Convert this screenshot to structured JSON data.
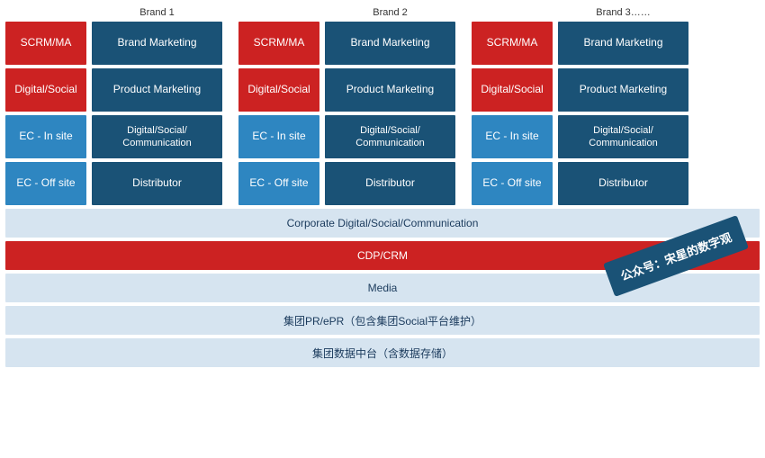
{
  "brands": [
    "Brand 1",
    "Brand 2",
    "Brand 3……"
  ],
  "rows": [
    {
      "cells": [
        {
          "label": "SCRM/MA",
          "type": "red",
          "width": "narrow"
        },
        {
          "label": "Brand Marketing",
          "type": "blue",
          "width": "wide"
        },
        {
          "label": "SCRM/MA",
          "type": "red",
          "width": "narrow"
        },
        {
          "label": "Brand Marketing",
          "type": "blue",
          "width": "wide"
        },
        {
          "label": "SCRM/MA",
          "type": "red",
          "width": "narrow"
        },
        {
          "label": "Brand Marketing",
          "type": "blue",
          "width": "wide"
        }
      ]
    },
    {
      "cells": [
        {
          "label": "Digital/Social",
          "type": "red",
          "width": "narrow"
        },
        {
          "label": "Product Marketing",
          "type": "blue",
          "width": "wide"
        },
        {
          "label": "Digital/Social",
          "type": "red",
          "width": "narrow"
        },
        {
          "label": "Product Marketing",
          "type": "blue",
          "width": "wide"
        },
        {
          "label": "Digital/Social",
          "type": "red",
          "width": "narrow"
        },
        {
          "label": "Product Marketing",
          "type": "blue",
          "width": "wide"
        }
      ]
    },
    {
      "cells": [
        {
          "label": "EC - In site",
          "type": "blue",
          "width": "narrow"
        },
        {
          "label": "Digital/Social/\nCommunication",
          "type": "blue",
          "width": "wide"
        },
        {
          "label": "EC - In site",
          "type": "blue",
          "width": "narrow"
        },
        {
          "label": "Digital/Social/\nCommunication",
          "type": "blue",
          "width": "wide"
        },
        {
          "label": "EC - In site",
          "type": "blue",
          "width": "narrow"
        },
        {
          "label": "Digital/Social/\nCommunication",
          "type": "blue",
          "width": "wide"
        }
      ]
    },
    {
      "cells": [
        {
          "label": "EC - Off site",
          "type": "blue",
          "width": "narrow"
        },
        {
          "label": "Distributor",
          "type": "blue",
          "width": "wide"
        },
        {
          "label": "EC - Off site",
          "type": "blue",
          "width": "narrow"
        },
        {
          "label": "Distributor",
          "type": "blue",
          "width": "wide"
        },
        {
          "label": "EC - Off site",
          "type": "blue",
          "width": "narrow"
        },
        {
          "label": "Distributor",
          "type": "blue",
          "width": "wide"
        }
      ]
    }
  ],
  "bottom_rows": [
    {
      "label": "Corporate Digital/Social/Communication",
      "type": "light"
    },
    {
      "label": "CDP/CRM",
      "type": "red"
    },
    {
      "label": "Media",
      "type": "light"
    },
    {
      "label": "集团PR/ePR（包含集团Social平台维护）",
      "type": "light"
    },
    {
      "label": "集团数据中台（含数据存储）",
      "type": "light"
    }
  ],
  "watermark": "公众号：宋星的数字观"
}
